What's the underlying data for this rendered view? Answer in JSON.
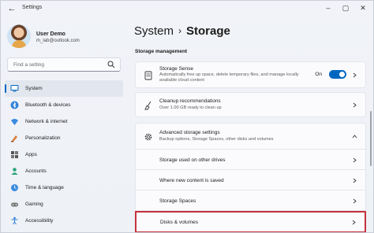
{
  "window": {
    "title": "Settings"
  },
  "user": {
    "name": "User Demo",
    "email": "m_lab@outlook.com"
  },
  "search": {
    "placeholder": "Find a setting"
  },
  "nav": {
    "items": [
      {
        "label": "System",
        "icon": "system-icon",
        "active": true
      },
      {
        "label": "Bluetooth & devices",
        "icon": "bluetooth-icon"
      },
      {
        "label": "Network & internet",
        "icon": "network-icon"
      },
      {
        "label": "Personalization",
        "icon": "personalization-icon"
      },
      {
        "label": "Apps",
        "icon": "apps-icon"
      },
      {
        "label": "Accounts",
        "icon": "accounts-icon"
      },
      {
        "label": "Time & language",
        "icon": "time-language-icon"
      },
      {
        "label": "Gaming",
        "icon": "gaming-icon"
      },
      {
        "label": "Accessibility",
        "icon": "accessibility-icon"
      }
    ]
  },
  "breadcrumb": {
    "parent": "System",
    "separator": "›",
    "current": "Storage"
  },
  "storage": {
    "section_title": "Storage management",
    "storage_sense": {
      "title": "Storage Sense",
      "description": "Automatically free up space, delete temporary files, and manage locally available cloud content",
      "toggle_label": "On",
      "toggle_on": true
    },
    "cleanup": {
      "title": "Cleanup recommendations",
      "description": "Over 1.00 GB ready to clean up"
    },
    "advanced": {
      "title": "Advanced storage settings",
      "description": "Backup options, Storage Spaces, other disks and volumes",
      "expanded": true,
      "subitems": [
        {
          "label": "Storage used on other drives"
        },
        {
          "label": "Where new content is saved"
        },
        {
          "label": "Storage Spaces"
        },
        {
          "label": "Disks & volumes",
          "highlighted": true
        }
      ]
    }
  },
  "colors": {
    "accent": "#0067c0",
    "highlight": "#c4323d"
  }
}
